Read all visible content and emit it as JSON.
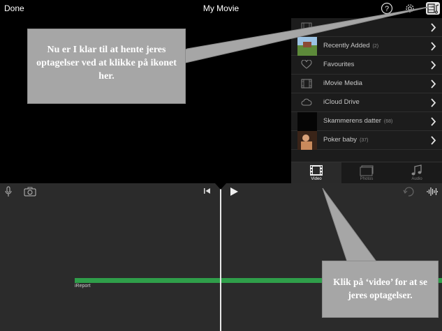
{
  "topbar": {
    "done_label": "Done",
    "title": "My Movie",
    "icons": [
      "help-icon",
      "settings-gear-icon",
      "media-library-icon"
    ]
  },
  "media_panel": {
    "items": [
      {
        "label": "",
        "count": "",
        "icon": "film-icon"
      },
      {
        "label": "Recently Added",
        "count": "(2)",
        "icon": "thumbnail"
      },
      {
        "label": "Favourites",
        "count": "",
        "icon": "heart-icon"
      },
      {
        "label": "iMovie Media",
        "count": "",
        "icon": "film-icon"
      },
      {
        "label": "iCloud Drive",
        "count": "",
        "icon": "cloud-icon"
      },
      {
        "label": "Skammerens datter",
        "count": "(68)",
        "icon": "thumbnail"
      },
      {
        "label": "Poker baby",
        "count": "(37)",
        "icon": "thumbnail"
      }
    ],
    "tabs": [
      {
        "label": "Video",
        "icon": "video-film-icon",
        "active": true
      },
      {
        "label": "Photos",
        "icon": "photos-icon",
        "active": false
      },
      {
        "label": "Audio",
        "icon": "music-note-icon",
        "active": false
      }
    ]
  },
  "timeline": {
    "clip_label": "iReport",
    "icons": [
      "microphone-icon",
      "camera-icon",
      "skip-back-icon",
      "play-icon",
      "undo-icon",
      "audio-waveform-icon"
    ]
  },
  "callouts": {
    "first": "Nu er I klar til at hente jeres optagelser ved at klikke på ikonet her.",
    "second": "Klik på ‘video’ for at se jeres optagelser."
  },
  "colors": {
    "clip_green": "#2f9e4a",
    "callout_gray": "#a6a6a6",
    "timeline_bg": "#2b2b2b"
  }
}
